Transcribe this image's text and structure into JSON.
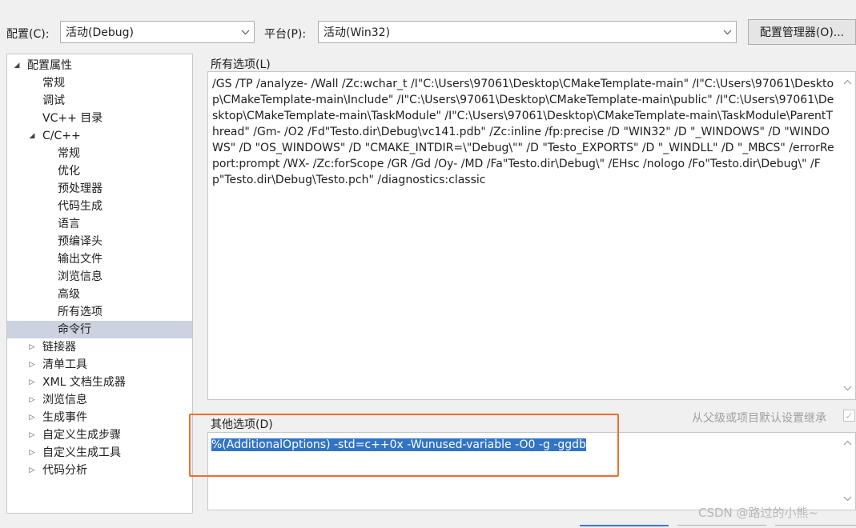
{
  "toolbar": {
    "config_label": "配置(C):",
    "config_value": "活动(Debug)",
    "platform_label": "平台(P):",
    "platform_value": "活动(Win32)",
    "manager_button": "配置管理器(O)..."
  },
  "tree": {
    "root_label": "配置属性",
    "items": [
      {
        "label": "常规",
        "level": 1
      },
      {
        "label": "调试",
        "level": 1
      },
      {
        "label": "VC++ 目录",
        "level": 1
      },
      {
        "label": "C/C++",
        "level": 1,
        "expanded": true
      },
      {
        "label": "常规",
        "level": 2
      },
      {
        "label": "优化",
        "level": 2
      },
      {
        "label": "预处理器",
        "level": 2
      },
      {
        "label": "代码生成",
        "level": 2
      },
      {
        "label": "语言",
        "level": 2
      },
      {
        "label": "预编译头",
        "level": 2
      },
      {
        "label": "输出文件",
        "level": 2
      },
      {
        "label": "浏览信息",
        "level": 2
      },
      {
        "label": "高级",
        "level": 2
      },
      {
        "label": "所有选项",
        "level": 2
      },
      {
        "label": "命令行",
        "level": 2,
        "selected": true
      },
      {
        "label": "链接器",
        "level": 1,
        "collapsed": true
      },
      {
        "label": "清单工具",
        "level": 1,
        "collapsed": true
      },
      {
        "label": "XML 文档生成器",
        "level": 1,
        "collapsed": true
      },
      {
        "label": "浏览信息",
        "level": 1,
        "collapsed": true
      },
      {
        "label": "生成事件",
        "level": 1,
        "collapsed": true
      },
      {
        "label": "自定义生成步骤",
        "level": 1,
        "collapsed": true
      },
      {
        "label": "自定义生成工具",
        "level": 1,
        "collapsed": true
      },
      {
        "label": "代码分析",
        "level": 1,
        "collapsed": true
      }
    ]
  },
  "all_options": {
    "label": "所有选项(L)",
    "text": "/GS /TP /analyze- /Wall /Zc:wchar_t /I\"C:\\Users\\97061\\Desktop\\CMakeTemplate-main\" /I\"C:\\Users\\97061\\Desktop\\CMakeTemplate-main\\Include\" /I\"C:\\Users\\97061\\Desktop\\CMakeTemplate-main\\public\" /I\"C:\\Users\\97061\\Desktop\\CMakeTemplate-main\\TaskModule\" /I\"C:\\Users\\97061\\Desktop\\CMakeTemplate-main\\TaskModule\\ParentThread\" /Gm- /O2 /Fd\"Testo.dir\\Debug\\vc141.pdb\" /Zc:inline /fp:precise /D \"WIN32\" /D \"_WINDOWS\" /D \"WINDOWS\" /D \"OS_WINDOWS\" /D \"CMAKE_INTDIR=\\\"Debug\\\"\" /D \"Testo_EXPORTS\" /D \"_WINDLL\" /D \"_MBCS\" /errorReport:prompt /WX- /Zc:forScope /GR /Gd /Oy- /MD /Fa\"Testo.dir\\Debug\\\" /EHsc /nologo /Fo\"Testo.dir\\Debug\\\" /Fp\"Testo.dir\\Debug\\Testo.pch\" /diagnostics:classic"
  },
  "inherit": {
    "label": "从父级或项目默认设置继承",
    "check_mark": "✓"
  },
  "other_options": {
    "label": "其他选项(D)",
    "value": "%(AdditionalOptions) -std=c++0x -Wunused-variable -O0 -g -ggdb"
  },
  "watermark": "CSDN @路过的小熊~",
  "icons": {
    "dropdown": "chevron-down-icon",
    "expanded": "triangle-expanded-icon",
    "collapsed": "triangle-collapsed-icon"
  },
  "colors": {
    "selection": "#3173c6",
    "tree_selected": "#ccd2df",
    "highlight_border": "#ee6e32"
  }
}
